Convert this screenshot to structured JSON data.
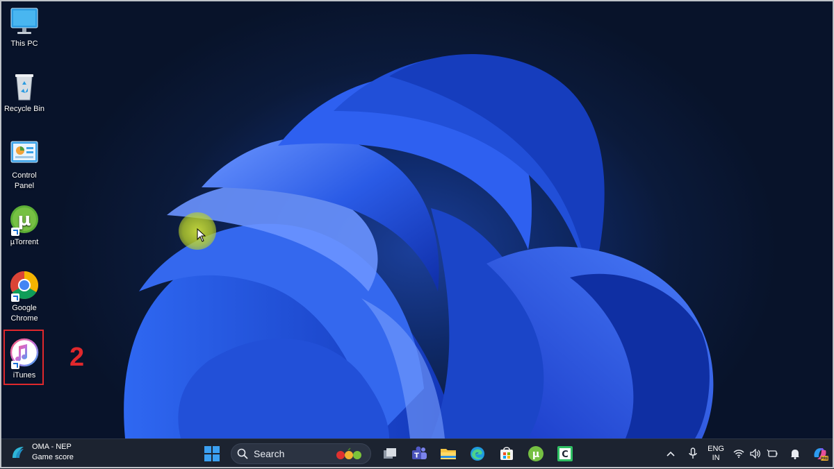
{
  "desktop": {
    "icons": [
      {
        "label": "This PC"
      },
      {
        "label": "Recycle Bin"
      },
      {
        "label": "Control Panel"
      },
      {
        "label": "µTorrent"
      },
      {
        "label": "Google Chrome"
      },
      {
        "label": "iTunes"
      }
    ],
    "step_label": "2",
    "highlight_color": "#e0282c"
  },
  "taskbar": {
    "widget": {
      "title": "OMA - NEP",
      "subtitle": "Game score"
    },
    "search": {
      "placeholder": "Search"
    },
    "tray": {
      "lang_primary": "ENG",
      "lang_secondary": "IN"
    }
  },
  "colors": {
    "accent": "#1a6fd6",
    "taskbar_bg": "#1c2330"
  }
}
